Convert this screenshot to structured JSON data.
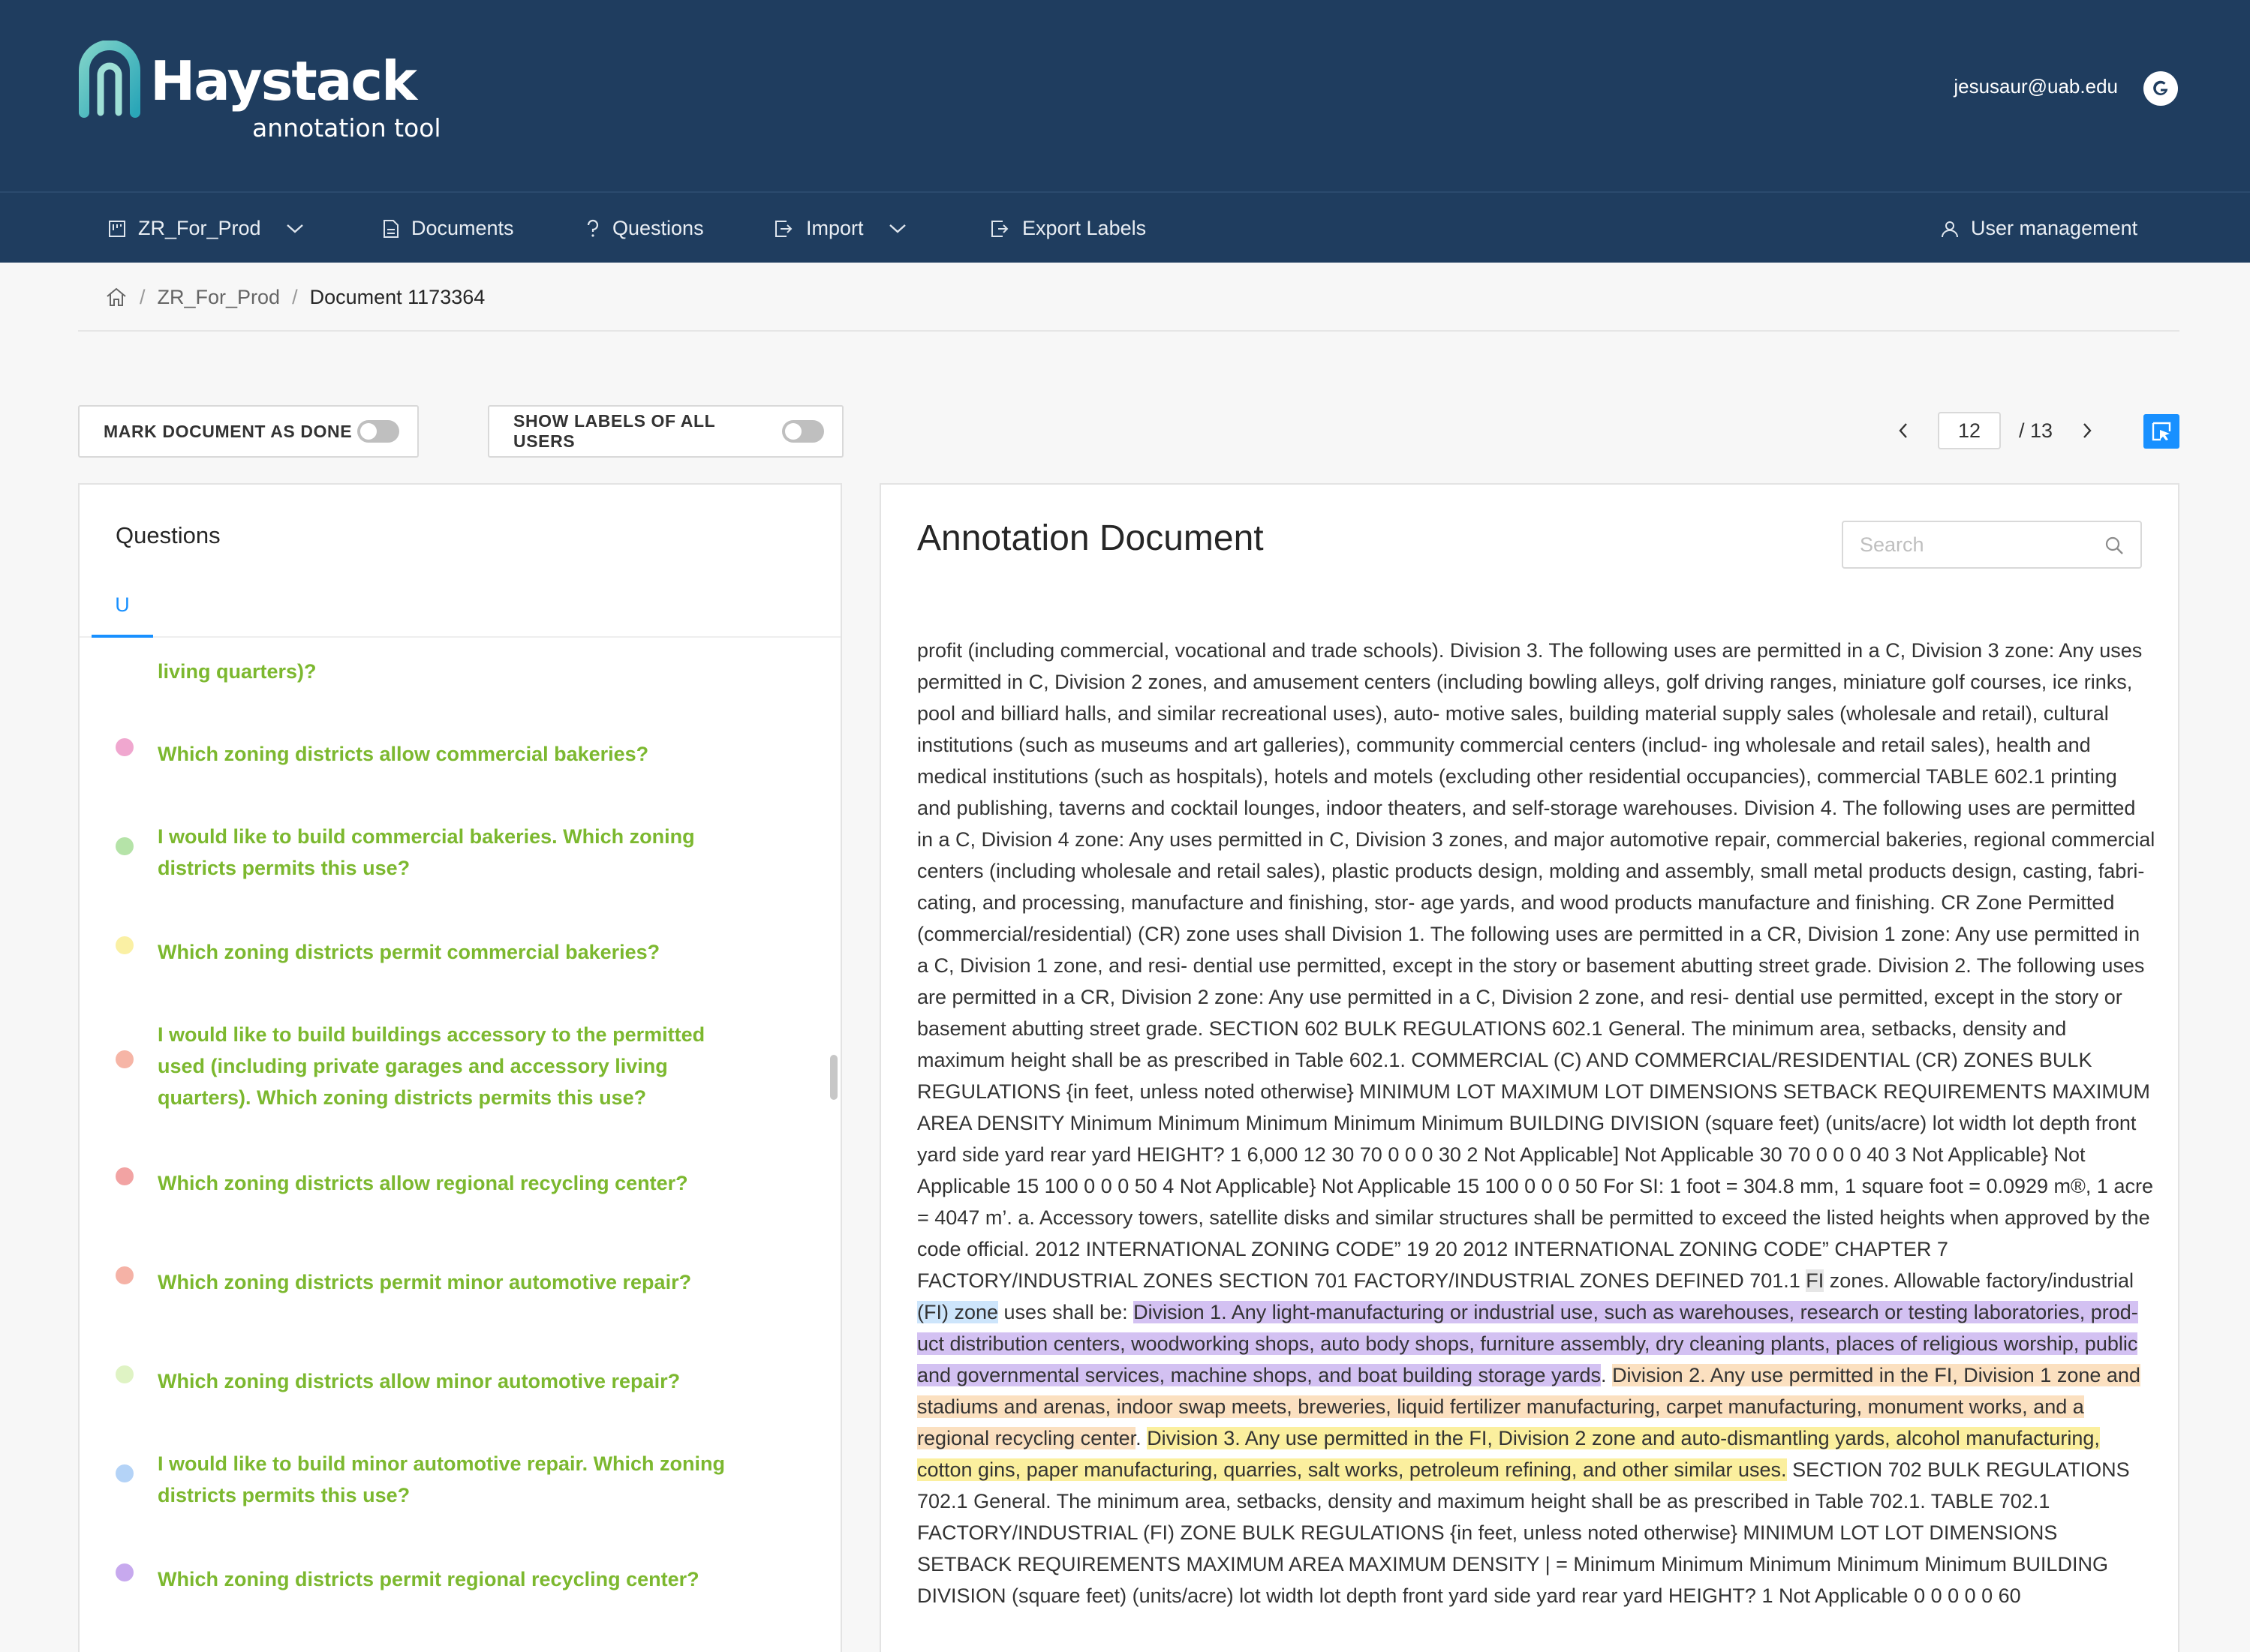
{
  "app": {
    "logo_title": "Haystack",
    "logo_subtitle": "annotation tool",
    "user_email": "jesusaur@uab.edu",
    "brand_color": "#1f3d5f",
    "accent_color": "#1890ff"
  },
  "nav": {
    "project": "ZR_For_Prod",
    "documents": "Documents",
    "questions": "Questions",
    "import": "Import",
    "export": "Export Labels",
    "user_management": "User management"
  },
  "breadcrumb": {
    "project": "ZR_For_Prod",
    "current": "Document 1173364"
  },
  "toggles": {
    "mark_done": "MARK DOCUMENT AS DONE",
    "mark_done_on": false,
    "show_all_labels": "SHOW LABELS OF ALL USERS",
    "show_all_labels_on": false
  },
  "pager": {
    "current": "12",
    "total": "/  13"
  },
  "questions_panel": {
    "title": "Questions",
    "tab": "U",
    "items": [
      {
        "text": "living quarters)?",
        "dot": ""
      },
      {
        "text": "Which zoning districts allow commercial bakeries?",
        "dot": "#f0a7cf"
      },
      {
        "text": "I would like to build commercial bakeries. Which zoning districts permits this use?",
        "dot": "#b5e3a8"
      },
      {
        "text": "Which zoning districts permit commercial bakeries?",
        "dot": "#faf0a4"
      },
      {
        "text": "I would like to build buildings accessory to the permitted used (including private garages and accessory living quarters). Which zoning districts permits this use?",
        "dot": "#f6b5a6"
      },
      {
        "text": "Which zoning districts allow regional recycling center?",
        "dot": "#f2a3a3"
      },
      {
        "text": "Which zoning districts permit minor automotive repair?",
        "dot": "#f5b2a6"
      },
      {
        "text": "Which zoning districts allow minor automotive repair?",
        "dot": "#dff3c4"
      },
      {
        "text": "I would like to build minor automotive repair. Which zoning districts permits this use?",
        "dot": "#b4d3f7"
      },
      {
        "text": "Which zoning districts permit regional recycling center?",
        "dot": "#c7a9ee"
      }
    ]
  },
  "document": {
    "title": "Annotation Document",
    "search_placeholder": "Search",
    "segments": [
      {
        "text": "profit (including commercial, vocational and trade schools). Division 3. The following uses are permitted in a C, Division 3 zone: Any uses permitted in C, Division 2 zones, and amusement centers (including bowling alleys, golf driving ranges, miniature golf courses, ice rinks, pool and billiard halls, and similar recreational uses), auto- motive sales, building material supply sales (wholesale and retail), cultural institutions (such as museums and art galleries), community commercial centers (includ- ing wholesale and retail sales), health and medical institutions (such as hospitals), hotels and motels (excluding other residential occupancies), commercial TABLE 602.1 printing and publishing, taverns and cocktail lounges, indoor theaters, and self-storage warehouses. Division 4. The following uses are permitted in a C, Division 4 zone: Any uses permitted in C, Division 3 zones, and major automotive repair, commercial bakeries, regional commercial centers (including wholesale and retail sales), plastic products design, molding and assembly, small metal products design, casting, fabri- cating, and processing, manufacture and finishing, stor- age yards, and wood products manufacture and finishing. CR Zone Permitted (commercial/residential) (CR) zone uses shall Division 1. The following uses are permitted in a CR, Division 1 zone: Any use permitted in a C, Division 1 zone, and resi- dential use permitted, except in the story or basement abutting street grade. Division 2. The following uses are permitted in a CR, Division 2 zone: Any use permitted in a C, Division 2 zone, and resi- dential use permitted, except in the story or basement abutting street grade. SECTION 602 BULK REGULATIONS 602.1 General. The minimum area, setbacks, density and maximum height shall be as prescribed in Table 602.1. COMMERCIAL (C) AND COMMERCIAL/RESIDENTIAL (CR) ZONES BULK REGULATIONS {in feet, unless noted otherwise}              MINIMUM LOT MAXIMUM LOT DIMENSIONS SETBACK REQUIREMENTS MAXIMUM AREA DENSITY Minimum Minimum Minimum Minimum Minimum BUILDING DIVISION (square feet) (units/acre) lot width lot depth front yard side yard rear yard HEIGHT? 1 6,000 12 30 70 0 0 0 30 2 Not Applicable] Not Applicable 30 70 0 0 0 40 3 Not Applicable} Not Applicable 15 100 0 0 0 50 4 Not Applicable} Not Applicable 15 100 0 0 0 50 For SI: 1 foot = 304.8 mm, 1 square foot = 0.0929 m®, 1 acre = 4047 m’. a. Accessory towers, satellite disks and similar structures shall be permitted to exceed the listed heights when approved by the code official. 2012 INTERNATIONAL ZONING CODE” 19 20 2012 INTERNATIONAL ZONING CODE” CHAPTER 7 FACTORY/INDUSTRIAL ZONES SECTION 701 FACTORY/INDUSTRIAL ZONES DEFINED 701.1 ",
        "hl": ""
      },
      {
        "text": "FI",
        "hl": "grey"
      },
      {
        "text": " zones. Allowable factory/industrial",
        "hl": ""
      },
      {
        "text": " (FI) zone",
        "hl": "blue"
      },
      {
        "text": " uses shall be: ",
        "hl": ""
      },
      {
        "text": "Division 1. Any light-manufacturing or industrial use, such as warehouses, research or testing laboratories, prod- uct distribution centers, woodworking shops, auto body shops, furniture assembly, dry cleaning plants, places of religious worship, public and governmental services, machine shops, and boat building storage yards",
        "hl": "purple"
      },
      {
        "text": ". ",
        "hl": ""
      },
      {
        "text": "Division 2. Any use permitted in the FI, Division 1 zone and stadiums and arenas, indoor swap meets, breweries, liquid fertilizer manufacturing, carpet manufacturing, monument works, and a regional recycling center",
        "hl": "orange"
      },
      {
        "text": ". ",
        "hl": ""
      },
      {
        "text": "Division 3. Any use permitted in the FI, Division 2 zone and auto-dismantling yards, alcohol manufacturing, cotton gins, paper manufacturing, quarries, salt works, petroleum refining, and other similar uses.",
        "hl": "yellow"
      },
      {
        "text": " SECTION 702 BULK REGULATIONS 702.1 General. The minimum area, setbacks, density and maximum height shall be as prescribed in Table 702.1. TABLE 702.1 FACTORY/INDUSTRIAL (FI) ZONE BULK REGULATIONS {in feet, unless noted otherwise}      MINIMUM LOT LOT DIMENSIONS SETBACK REQUIREMENTS MAXIMUM AREA MAXIMUM DENSITY | = Minimum Minimum Minimum Minimum Minimum BUILDING DIVISION (square feet) (units/acre) lot width lot depth front yard side yard rear yard HEIGHT? 1 Not Applicable 0 0 0 0 0 60",
        "hl": ""
      }
    ]
  }
}
